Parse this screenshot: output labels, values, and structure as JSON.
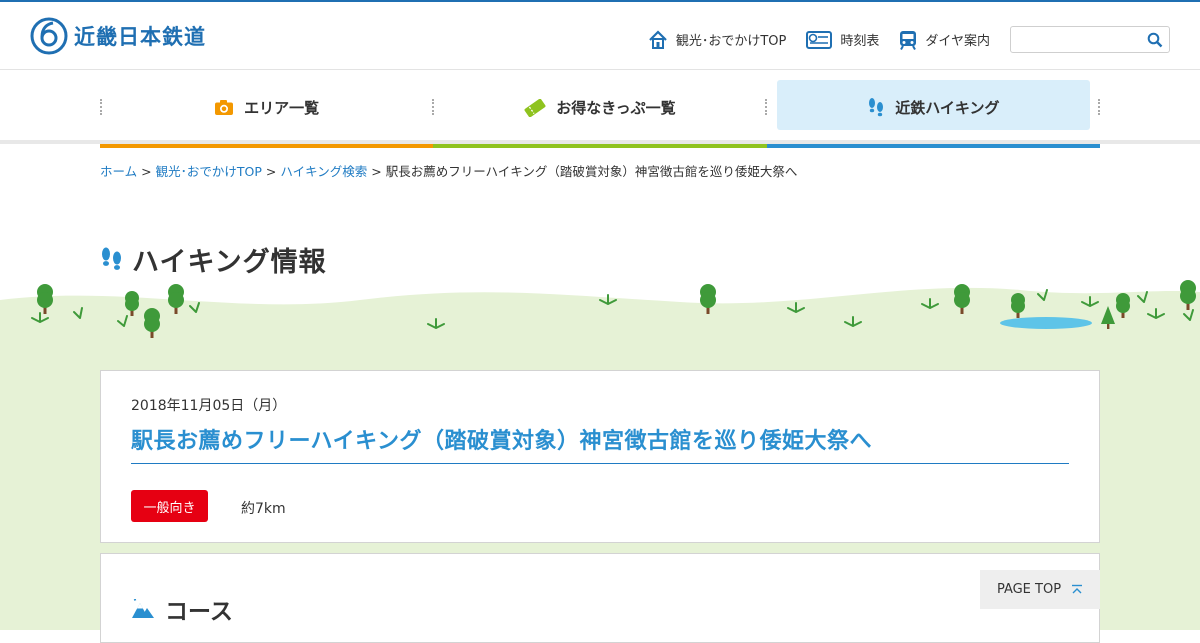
{
  "header": {
    "logo_text": "近畿日本鉄道",
    "links": [
      {
        "label": "観光･おでかけTOP",
        "icon": "home-icon"
      },
      {
        "label": "時刻表",
        "icon": "timetable-icon"
      },
      {
        "label": "ダイヤ案内",
        "icon": "train-icon"
      }
    ],
    "search_placeholder": ""
  },
  "gnav": {
    "items": [
      {
        "label": "エリア一覧",
        "icon": "camera-icon",
        "color": "#f39800"
      },
      {
        "label": "お得なきっぷ一覧",
        "icon": "ticket-icon",
        "color": "#8fc31f"
      },
      {
        "label": "近鉄ハイキング",
        "icon": "footprints-icon",
        "color": "#2a8fd0",
        "active": true
      }
    ]
  },
  "breadcrumb": {
    "items": [
      "ホーム",
      "観光･おでかけTOP",
      "ハイキング検索"
    ],
    "current": "駅長お薦めフリーハイキング（踏破賞対象）神宮徴古館を巡り倭姫大祭へ",
    "separator": ">"
  },
  "page_title": "ハイキング情報",
  "event": {
    "date": "2018年11月05日（月）",
    "title": "駅長お薦めフリーハイキング（踏破賞対象）神宮徴古館を巡り倭姫大祭へ",
    "level_badge": "一般向き",
    "distance": "約7km"
  },
  "course": {
    "heading": "コース"
  },
  "page_top_label": "PAGE TOP",
  "colors": {
    "brand_blue": "#1f6fb2",
    "link_blue": "#1f7bc3",
    "title_blue": "#2a8fd0",
    "badge_red": "#e60012",
    "grass": "#e6f2d6",
    "tree": "#3f9a3a"
  }
}
